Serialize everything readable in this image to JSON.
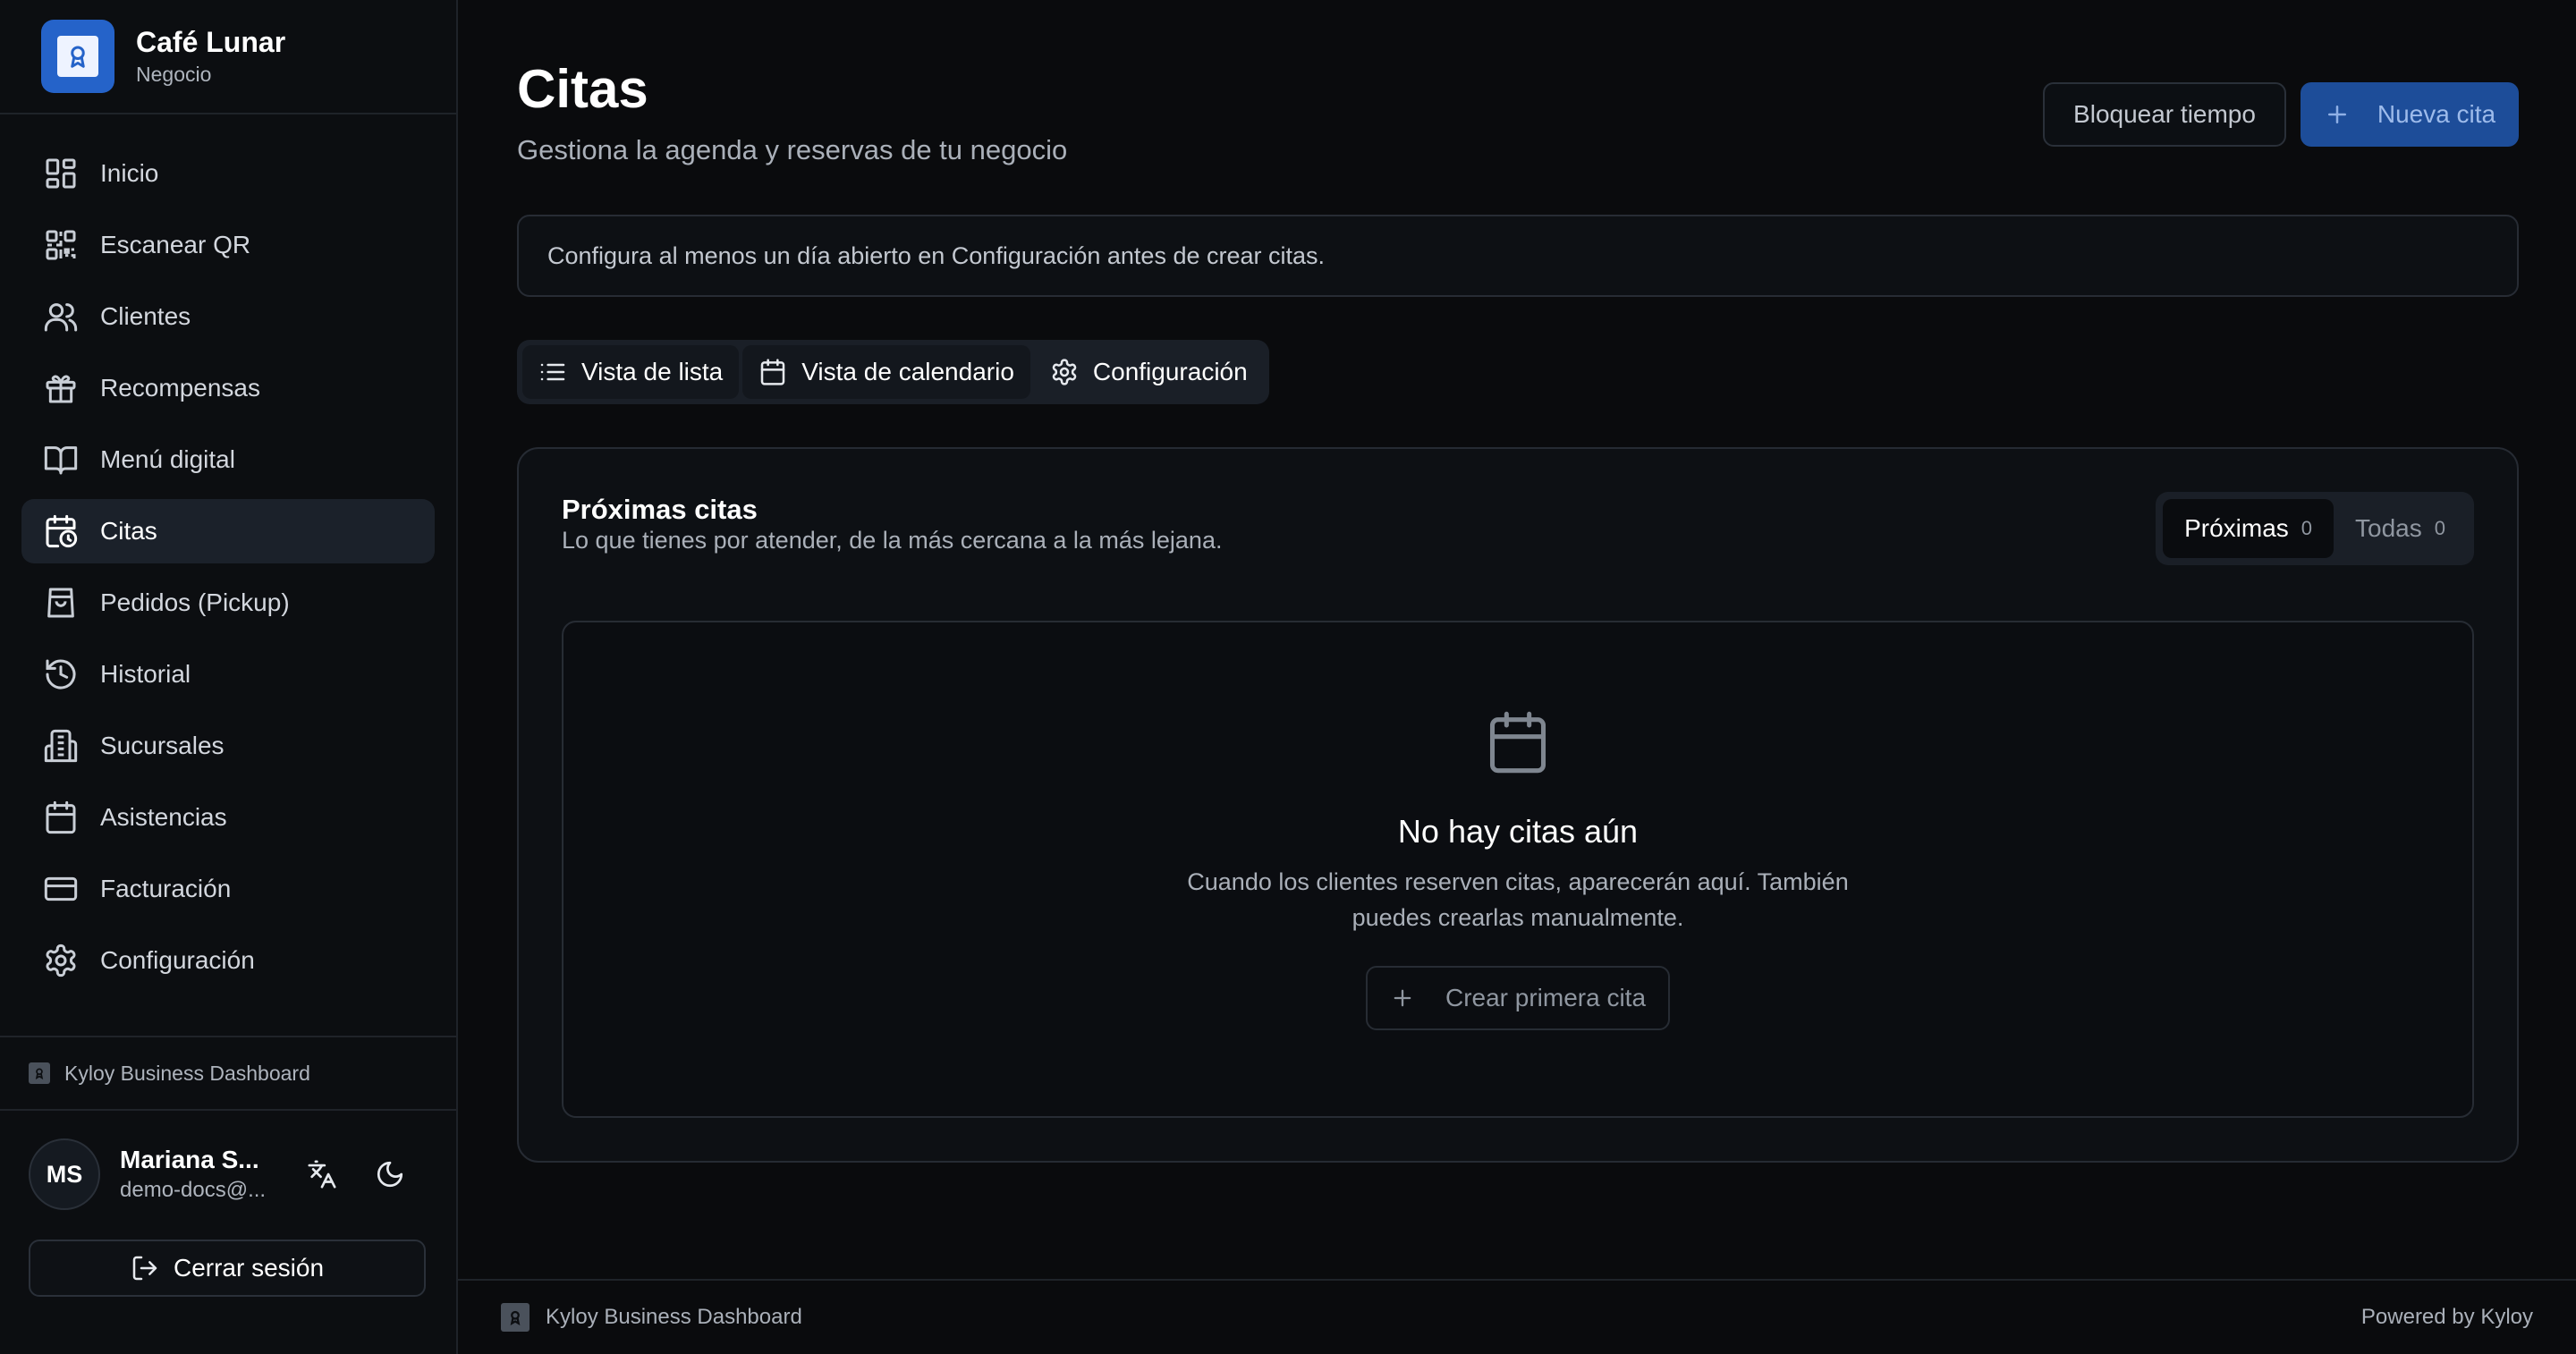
{
  "sidebar": {
    "brand_name": "Café Lunar",
    "brand_subtitle": "Negocio",
    "items": [
      {
        "label": "Inicio",
        "icon": "grid-icon"
      },
      {
        "label": "Escanear QR",
        "icon": "qr-code-icon"
      },
      {
        "label": "Clientes",
        "icon": "users-icon"
      },
      {
        "label": "Recompensas",
        "icon": "gift-icon"
      },
      {
        "label": "Menú digital",
        "icon": "book-open-icon"
      },
      {
        "label": "Citas",
        "icon": "calendar-clock-icon",
        "active": true
      },
      {
        "label": "Pedidos (Pickup)",
        "icon": "shopping-bag-icon"
      },
      {
        "label": "Historial",
        "icon": "history-icon"
      },
      {
        "label": "Sucursales",
        "icon": "building-icon"
      },
      {
        "label": "Asistencias",
        "icon": "calendar-icon"
      },
      {
        "label": "Facturación",
        "icon": "credit-card-icon"
      },
      {
        "label": "Configuración",
        "icon": "gear-icon"
      }
    ],
    "footer_brand": "Kyloy Business Dashboard",
    "user": {
      "initials": "MS",
      "name": "Mariana S...",
      "email": "demo-docs@..."
    },
    "logout_label": "Cerrar sesión"
  },
  "header": {
    "title": "Citas",
    "subtitle": "Gestiona la agenda y reservas de tu negocio",
    "block_time_label": "Bloquear tiempo",
    "new_appointment_label": "Nueva cita"
  },
  "notice": "Configura al menos un día abierto en Configuración antes de crear citas.",
  "view_tabs": [
    {
      "label": "Vista de lista",
      "icon": "list-icon"
    },
    {
      "label": "Vista de calendario",
      "icon": "calendar-icon"
    },
    {
      "label": "Configuración",
      "icon": "gear-icon"
    }
  ],
  "card": {
    "title": "Próximas citas",
    "subtitle": "Lo que tienes por atender, de la más cercana a la más lejana.",
    "filters": [
      {
        "label": "Próximas",
        "count": "0",
        "active": true
      },
      {
        "label": "Todas",
        "count": "0"
      }
    ],
    "empty": {
      "title": "No hay citas aún",
      "description": "Cuando los clientes reserven citas, aparecerán aquí. También puedes crearlas manualmente.",
      "button_label": "Crear primera cita"
    }
  },
  "footer": {
    "brand": "Kyloy Business Dashboard",
    "powered_by": "Powered by Kyloy"
  },
  "colors": {
    "background": "#0a0b0d",
    "primary": "#1d4d99",
    "brand_logo": "#2563c9",
    "active_nav": "#1b212a"
  }
}
